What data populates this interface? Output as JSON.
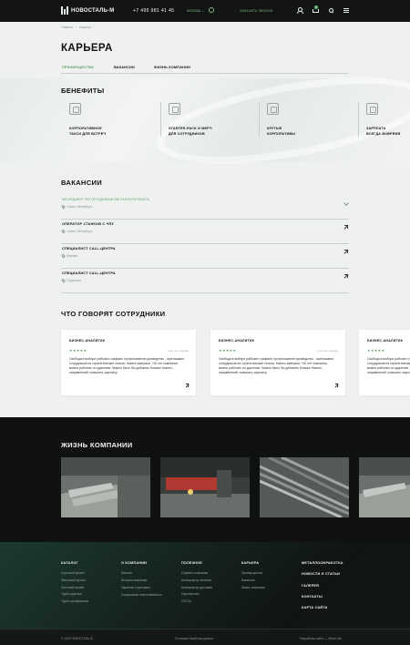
{
  "header": {
    "logo_text": "НОВОСТАЛЬ-М",
    "phone": "+7 495 981 41 45",
    "city": "МОСКВА ⌄",
    "callback": "ЗАКАЗАТЬ ЗВОНОК"
  },
  "breadcrumbs": [
    "Главная",
    "Карьера"
  ],
  "page": {
    "title": "КАРЬЕРА",
    "tabs": [
      "ПРЕИМУЩЕСТВА",
      "ВАКАНСИИ",
      "ЖИЗНЬ КОМПАНИИ"
    ]
  },
  "benefits": {
    "title": "БЕНЕФИТЫ",
    "items": [
      {
        "label": "КОРПОРАТИВНОЕ\nТАКСИ ДЛЯ ВСТРЕЧ"
      },
      {
        "label": "STARTER-PACK И МЕРЧ\nДЛЯ СОТРУДНИКОВ"
      },
      {
        "label": "КРУТЫЕ\nКОРПОРАТИВЫ"
      },
      {
        "label": "ЗАРПЛАТА\nВСЕГДА ВОВРЕМЯ"
      }
    ]
  },
  "vacancies": {
    "title": "ВАКАНСИИ",
    "items": [
      {
        "name": "МЕНЕДЖЕР ПО ПРОДАЖАМ МЕТАЛЛОПРОКАТА",
        "location": "Санкт-Петербург"
      },
      {
        "name": "ОПЕРАТОР СТАНКОВ С ЧПУ",
        "location": "Санкт-Петербург"
      },
      {
        "name": "СПЕЦИАЛИСТ CALL-ЦЕНТРА",
        "location": "Москва"
      },
      {
        "name": "СПЕЦИАЛИСТ CALL-ЦЕНТРА",
        "location": "Подольск"
      }
    ]
  },
  "reviews": {
    "title": "ЧТО ГОВОРЯТ СОТРУДНИКИ",
    "items": [
      {
        "role": "БИЗНЕС-АНАЛИТИК",
        "stars": "★★★★★",
        "date": "пять лет подряд",
        "text": "Свобода в выборе рабочего графика, прогрессивное руководство - приглашают сотрудников на стратегические сессии, бизнес-завтраки, +30 лет компании, можно работать из удаленки. Можно было бы добавить больше бизнес-направлений, повысить зарплату."
      },
      {
        "role": "БИЗНЕС-АНАЛИТИК",
        "stars": "★★★★★",
        "date": "пять лет подряд",
        "text": "Свобода в выборе рабочего графика, прогрессивное руководство - приглашают сотрудников на стратегические сессии, бизнес-завтраки, +30 лет компании, можно работать из удаленки. Можно было бы добавить больше бизнес-направлений, повысить зарплату."
      },
      {
        "role": "БИЗНЕС-АНАЛИТИК",
        "stars": "★★★★★",
        "date": "",
        "text": "Свобода в выборе рабочего графика, прогрессивное руководство - приглашают сотрудников на стратегические сессии, бизнес-завтраки, +30 лет компании, можно работать из удаленки. Можно было бы добавить больше бизнес-направлений, повысить зарплату."
      }
    ]
  },
  "life": {
    "title": "ЖИЗНЬ КОМПАНИИ"
  },
  "footer": {
    "catalog": {
      "title": "КАТАЛОГ",
      "links": [
        "Сортовой прокат",
        "Фасонный прокат",
        "Листовой прокат",
        "Трубы круглые",
        "Трубы профильные"
      ]
    },
    "company": {
      "title": "О КОМПАНИИ",
      "links": [
        "Миссия",
        "История компании",
        "Гарантии и доставки",
        "Социальная ответственность"
      ]
    },
    "useful": {
      "title": "ПОЛЕЗНОЕ",
      "links": [
        "Сервисы компании",
        "Калькулятор металла",
        "Калькулятор доставки",
        "Партнерство",
        "ГОСТы"
      ]
    },
    "career": {
      "title": "КАРЬЕРА",
      "links": [
        "Преимущества",
        "Вакансии",
        "Жизнь компании"
      ]
    },
    "big_links": [
      "МЕТАЛЛООБРАБОТКА",
      "НОВОСТИ И СТАТЬИ",
      "ГАЛЕРЕЯ",
      "КОНТАКТЫ",
      "КАРТА САЙТА"
    ],
    "copyright": "© 2023 НОВОСТАЛЬ-М",
    "privacy": "Политика обработки данных",
    "dev": "Разработка сайта — Hitech.site"
  },
  "colors": {
    "accent": "#5f9f6a",
    "dark": "#121513",
    "bg": "#eef1ef"
  }
}
